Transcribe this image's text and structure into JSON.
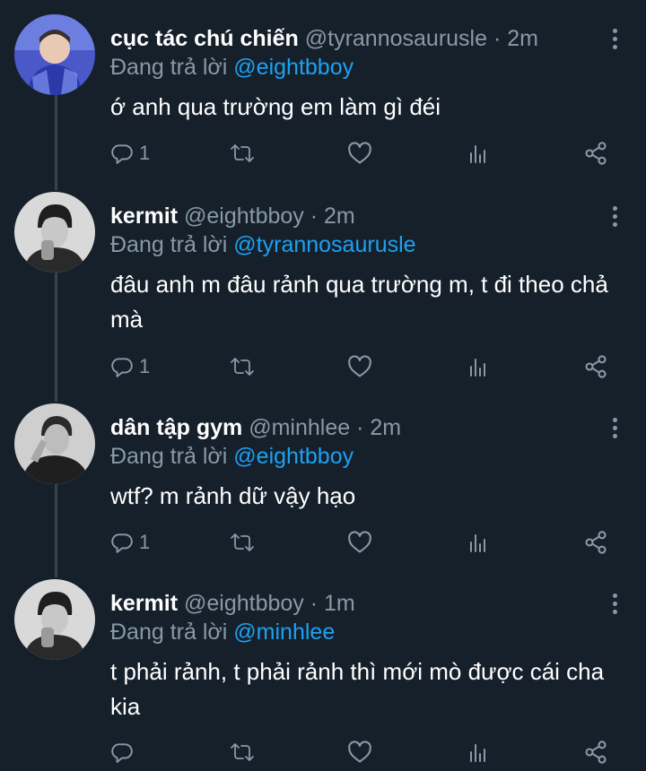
{
  "tweets": [
    {
      "name": "cục tác chú chiến",
      "handle": "@tyrannosaurusle",
      "time": "2m",
      "replying_label": "Đang trả lời",
      "replying_to": "@eightbboy",
      "text": "ớ anh qua trường em làm gì đéi",
      "reply_count": "1"
    },
    {
      "name": "kermit",
      "handle": "@eightbboy",
      "time": "2m",
      "replying_label": "Đang trả lời",
      "replying_to": "@tyrannosaurusle",
      "text": "đâu anh m đâu rảnh qua trường m, t đi theo chả mà",
      "reply_count": "1"
    },
    {
      "name": "dân tập gym",
      "handle": "@minhlee",
      "time": "2m",
      "replying_label": "Đang trả lời",
      "replying_to": "@eightbboy",
      "text": "wtf? m rảnh dữ vậy hạo",
      "reply_count": "1"
    },
    {
      "name": "kermit",
      "handle": "@eightbboy",
      "time": "1m",
      "replying_label": "Đang trả lời",
      "replying_to": "@minhlee",
      "text": "t phải rảnh, t phải rảnh thì mới mò được cái cha kia",
      "reply_count": ""
    }
  ],
  "separator": " · ",
  "colors": {
    "background": "#15202b",
    "secondary_text": "#8899a6",
    "mention": "#1da1f2",
    "thread_line": "#38444d"
  },
  "icons": [
    "reply-icon",
    "retweet-icon",
    "like-icon",
    "analytics-icon",
    "share-icon",
    "more-icon"
  ]
}
